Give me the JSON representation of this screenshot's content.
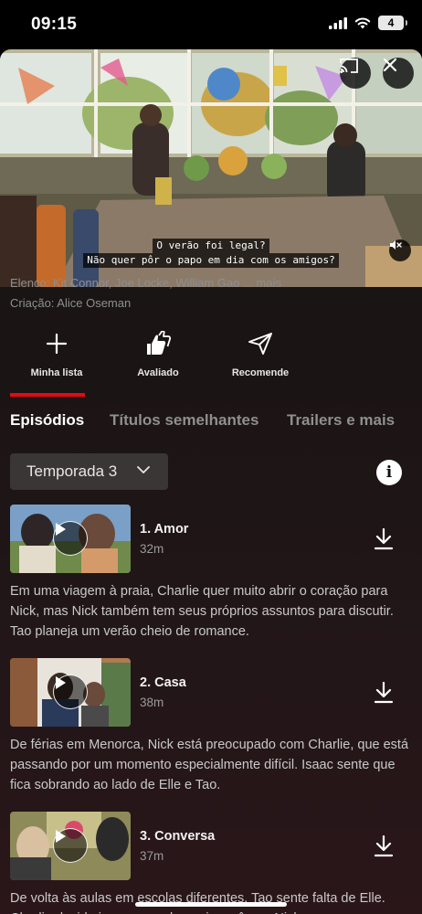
{
  "status_bar": {
    "time": "09:15",
    "battery": "4"
  },
  "player": {
    "subtitle_line1": "O verão foi legal?",
    "subtitle_line2": "Não quer pôr o papo em dia com os amigos?"
  },
  "details": {
    "cast": "Elenco: Kit Connor, Joe Locke, William Gao ... mais",
    "creator": "Criação: Alice Oseman"
  },
  "actions": [
    {
      "label": "Minha lista",
      "icon": "plus-icon"
    },
    {
      "label": "Avaliado",
      "icon": "double-thumbs-up-icon"
    },
    {
      "label": "Recomende",
      "icon": "send-icon"
    }
  ],
  "tabs": [
    {
      "label": "Episódios",
      "active": true
    },
    {
      "label": "Títulos semelhantes",
      "active": false
    },
    {
      "label": "Trailers e mais",
      "active": false
    }
  ],
  "season_selector": {
    "selected": "Temporada 3"
  },
  "episodes": [
    {
      "title": "1. Amor",
      "duration": "32m",
      "description": "Em uma viagem à praia, Charlie quer muito abrir o coração para Nick, mas Nick também tem seus próprios assuntos para discutir. Tao planeja um verão cheio de romance."
    },
    {
      "title": "2. Casa",
      "duration": "38m",
      "description": "De férias em Menorca, Nick está preocupado com Charlie, que está passando por um momento especialmente difícil. Isaac sente que fica sobrando ao lado de Elle e Tao."
    },
    {
      "title": "3. Conversa",
      "duration": "37m",
      "description": "De volta às aulas em escolas diferentes, Tao sente falta de Elle. Charlie decide ir ao grupo de apoio e vê que Nick..."
    }
  ],
  "colors": {
    "accent": "#e50914",
    "background": "#1c1818",
    "text_muted": "#8f8f8f"
  }
}
